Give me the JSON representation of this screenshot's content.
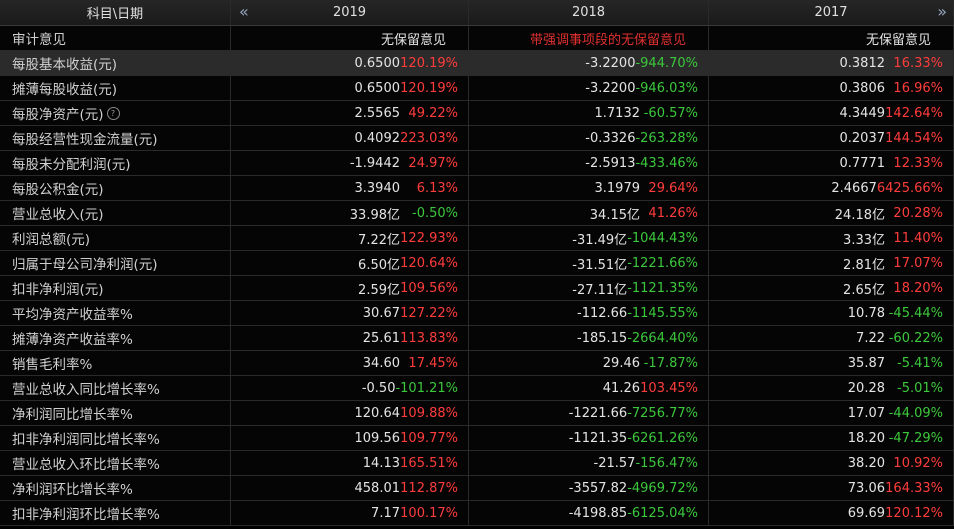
{
  "header": {
    "label": "科目\\日期",
    "years": [
      "2019",
      "2018",
      "2017"
    ],
    "nav_left": "«",
    "nav_right": "»"
  },
  "colors": {
    "up": "#ff3c3c",
    "down": "#3cc83c",
    "warning": "#e03030"
  },
  "audit": {
    "label": "审计意见",
    "values": [
      "无保留意见",
      "带强调事项段的无保留意见",
      "无保留意见"
    ],
    "warn": [
      false,
      true,
      false
    ]
  },
  "rows": [
    {
      "label": "每股基本收益(元)",
      "help": false,
      "cells": [
        [
          "0.6500",
          "120.19%",
          "up"
        ],
        [
          "-3.2200",
          "-944.70%",
          "down"
        ],
        [
          "0.3812",
          "16.33%",
          "up"
        ]
      ]
    },
    {
      "label": "摊薄每股收益(元)",
      "help": false,
      "cells": [
        [
          "0.6500",
          "120.19%",
          "up"
        ],
        [
          "-3.2200",
          "-946.03%",
          "down"
        ],
        [
          "0.3806",
          "16.96%",
          "up"
        ]
      ]
    },
    {
      "label": "每股净资产(元)",
      "help": true,
      "cells": [
        [
          "2.5565",
          "49.22%",
          "up"
        ],
        [
          "1.7132",
          "-60.57%",
          "down"
        ],
        [
          "4.3449",
          "142.64%",
          "up"
        ]
      ]
    },
    {
      "label": "每股经营性现金流量(元)",
      "help": false,
      "cells": [
        [
          "0.4092",
          "223.03%",
          "up"
        ],
        [
          "-0.3326",
          "-263.28%",
          "down"
        ],
        [
          "0.2037",
          "144.54%",
          "up"
        ]
      ]
    },
    {
      "label": "每股未分配利润(元)",
      "help": false,
      "cells": [
        [
          "-1.9442",
          "24.97%",
          "up"
        ],
        [
          "-2.5913",
          "-433.46%",
          "down"
        ],
        [
          "0.7771",
          "12.33%",
          "up"
        ]
      ]
    },
    {
      "label": "每股公积金(元)",
      "help": false,
      "cells": [
        [
          "3.3940",
          "6.13%",
          "up"
        ],
        [
          "3.1979",
          "29.64%",
          "up"
        ],
        [
          "2.4667",
          "6425.66%",
          "up"
        ]
      ]
    },
    {
      "label": "营业总收入(元)",
      "help": false,
      "cells": [
        [
          "33.98亿",
          "-0.50%",
          "down"
        ],
        [
          "34.15亿",
          "41.26%",
          "up"
        ],
        [
          "24.18亿",
          "20.28%",
          "up"
        ]
      ]
    },
    {
      "label": "利润总额(元)",
      "help": false,
      "cells": [
        [
          "7.22亿",
          "122.93%",
          "up"
        ],
        [
          "-31.49亿",
          "-1044.43%",
          "down"
        ],
        [
          "3.33亿",
          "11.40%",
          "up"
        ]
      ]
    },
    {
      "label": "归属于母公司净利润(元)",
      "help": false,
      "cells": [
        [
          "6.50亿",
          "120.64%",
          "up"
        ],
        [
          "-31.51亿",
          "-1221.66%",
          "down"
        ],
        [
          "2.81亿",
          "17.07%",
          "up"
        ]
      ]
    },
    {
      "label": "扣非净利润(元)",
      "help": false,
      "cells": [
        [
          "2.59亿",
          "109.56%",
          "up"
        ],
        [
          "-27.11亿",
          "-1121.35%",
          "down"
        ],
        [
          "2.65亿",
          "18.20%",
          "up"
        ]
      ]
    },
    {
      "label": "平均净资产收益率%",
      "help": false,
      "cells": [
        [
          "30.67",
          "127.22%",
          "up"
        ],
        [
          "-112.66",
          "-1145.55%",
          "down"
        ],
        [
          "10.78",
          "-45.44%",
          "down"
        ]
      ]
    },
    {
      "label": "摊薄净资产收益率%",
      "help": false,
      "cells": [
        [
          "25.61",
          "113.83%",
          "up"
        ],
        [
          "-185.15",
          "-2664.40%",
          "down"
        ],
        [
          "7.22",
          "-60.22%",
          "down"
        ]
      ]
    },
    {
      "label": "销售毛利率%",
      "help": false,
      "cells": [
        [
          "34.60",
          "17.45%",
          "up"
        ],
        [
          "29.46",
          "-17.87%",
          "down"
        ],
        [
          "35.87",
          "-5.41%",
          "down"
        ]
      ]
    },
    {
      "label": "营业总收入同比增长率%",
      "help": false,
      "cells": [
        [
          "-0.50",
          "-101.21%",
          "down"
        ],
        [
          "41.26",
          "103.45%",
          "up"
        ],
        [
          "20.28",
          "-5.01%",
          "down"
        ]
      ]
    },
    {
      "label": "净利润同比增长率%",
      "help": false,
      "cells": [
        [
          "120.64",
          "109.88%",
          "up"
        ],
        [
          "-1221.66",
          "-7256.77%",
          "down"
        ],
        [
          "17.07",
          "-44.09%",
          "down"
        ]
      ]
    },
    {
      "label": "扣非净利润同比增长率%",
      "help": false,
      "cells": [
        [
          "109.56",
          "109.77%",
          "up"
        ],
        [
          "-1121.35",
          "-6261.26%",
          "down"
        ],
        [
          "18.20",
          "-47.29%",
          "down"
        ]
      ]
    },
    {
      "label": "营业总收入环比增长率%",
      "help": false,
      "cells": [
        [
          "14.13",
          "165.51%",
          "up"
        ],
        [
          "-21.57",
          "-156.47%",
          "down"
        ],
        [
          "38.20",
          "10.92%",
          "up"
        ]
      ]
    },
    {
      "label": "净利润环比增长率%",
      "help": false,
      "cells": [
        [
          "458.01",
          "112.87%",
          "up"
        ],
        [
          "-3557.82",
          "-4969.72%",
          "down"
        ],
        [
          "73.06",
          "164.33%",
          "up"
        ]
      ]
    },
    {
      "label": "扣非净利润环比增长率%",
      "help": false,
      "cells": [
        [
          "7.17",
          "100.17%",
          "up"
        ],
        [
          "-4198.85",
          "-6125.04%",
          "down"
        ],
        [
          "69.69",
          "120.12%",
          "up"
        ]
      ]
    }
  ],
  "highlighted_row": 0
}
